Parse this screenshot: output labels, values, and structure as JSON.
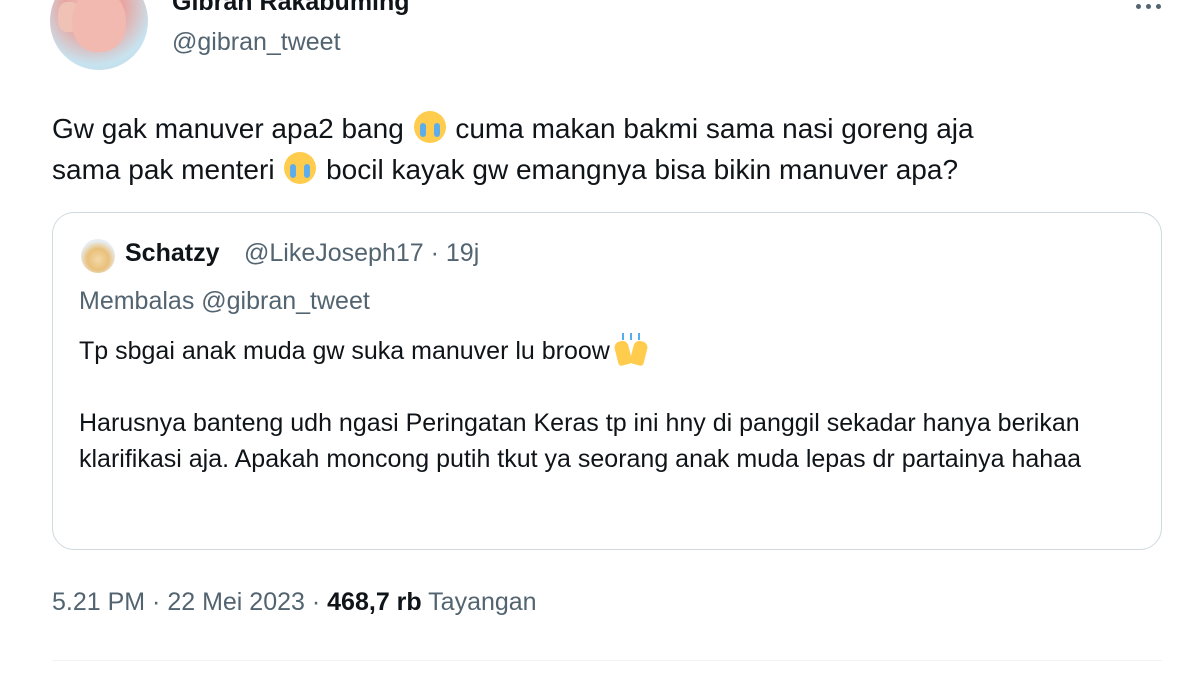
{
  "author": {
    "display_name": "Gibran Rakabuming",
    "handle": "@gibran_tweet",
    "avatar_icon": "profile-photo"
  },
  "tweet": {
    "text_line1_part1": "Gw gak manuver apa2 bang ",
    "text_line1_part2": " cuma makan bakmi sama nasi goreng aja",
    "text_line2_part1": "sama pak menteri ",
    "text_line2_part2": " bocil kayak gw emangnya bisa bikin manuver apa?",
    "emoji_icon": "loudly-crying-face-emoji"
  },
  "quote": {
    "display_name": "Schatzy",
    "handle": "@LikeJoseph17",
    "separator": " · ",
    "time_ago": "19j",
    "reply_prefix": "Membalas ",
    "reply_to": "@gibran_tweet",
    "paragraph1": "Tp sbgai anak muda gw suka manuver lu broow",
    "paragraph2": "Harusnya banteng udh ngasi Peringatan Keras tp ini hny di panggil sekadar hanya berikan klarifikasi aja. Apakah moncong putih tkut ya seorang anak muda lepas dr partainya hahaa",
    "emoji_icon": "raising-hands-emoji"
  },
  "footer": {
    "time": "5.21 PM",
    "separator": " · ",
    "date": "22 Mei 2023",
    "views_count": "468,7 rb",
    "views_label": " Tayangan"
  },
  "colors": {
    "primary_text": "#0f1419",
    "secondary_text": "#536471",
    "border": "#cfd9de"
  }
}
